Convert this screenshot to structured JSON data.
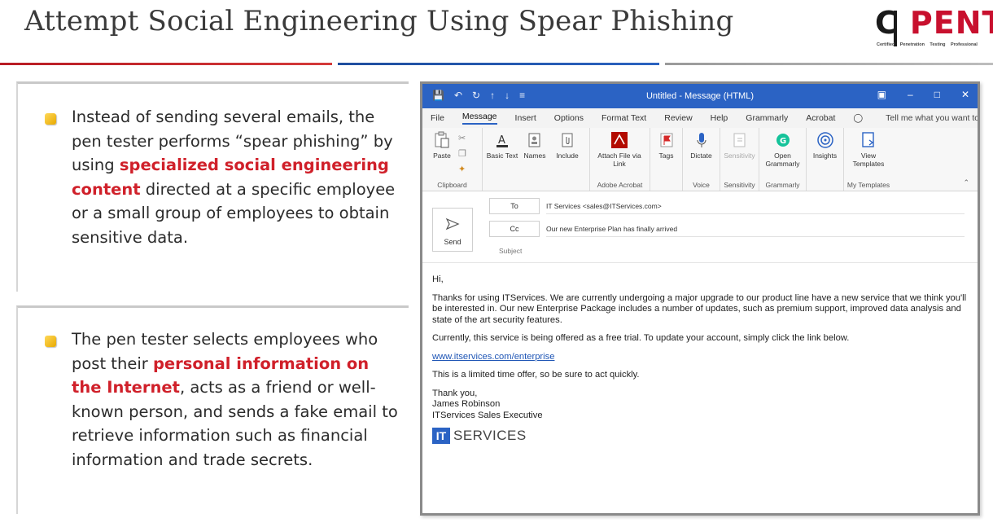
{
  "slide": {
    "title": "Attempt Social Engineering Using Spear Phishing",
    "logo": {
      "main_c": "C",
      "main_rest": "PENT",
      "sub_words": [
        "Certified",
        "Penetration",
        "Testing",
        "Professional"
      ]
    }
  },
  "bullets": [
    {
      "pre": "Instead of sending several emails, the pen tester performs “spear phishing” by using ",
      "highlight": "specialized social engineering content",
      "post": " directed at a specific employee or a small group of employees to obtain sensitive data."
    },
    {
      "pre": "The pen tester selects employees who post their ",
      "highlight": "personal information on the Internet",
      "post": ", acts as a friend or well-known person, and sends a fake email to retrieve information such as financial information and trade secrets."
    }
  ],
  "outlook": {
    "window_title": "Untitled  -  Message (HTML)",
    "menu": [
      "File",
      "Message",
      "Insert",
      "Options",
      "Format Text",
      "Review",
      "Help",
      "Grammarly",
      "Acrobat"
    ],
    "menu_active": "Message",
    "tell_me": "Tell me what you want to",
    "ribbon_groups": [
      {
        "label": "Clipboard",
        "buttons": [
          {
            "label": "Paste",
            "icon": "paste-icon"
          }
        ]
      },
      {
        "label": "",
        "buttons": [
          {
            "label": "Basic Text",
            "icon": "font-color-icon"
          },
          {
            "label": "Names",
            "icon": "address-book-icon"
          },
          {
            "label": "Include",
            "icon": "paperclip-icon"
          }
        ]
      },
      {
        "label": "Adobe Acrobat",
        "buttons": [
          {
            "label": "Attach File via Link",
            "icon": "acrobat-icon"
          }
        ]
      },
      {
        "label": "",
        "buttons": [
          {
            "label": "Tags",
            "icon": "flag-icon"
          }
        ]
      },
      {
        "label": "Voice",
        "buttons": [
          {
            "label": "Dictate",
            "icon": "microphone-icon"
          }
        ]
      },
      {
        "label": "Sensitivity",
        "buttons": [
          {
            "label": "Sensitivity",
            "icon": "sensitivity-icon"
          }
        ]
      },
      {
        "label": "Grammarly",
        "buttons": [
          {
            "label": "Open Grammarly",
            "icon": "grammarly-icon"
          }
        ]
      },
      {
        "label": "",
        "buttons": [
          {
            "label": "Insights",
            "icon": "insights-icon"
          }
        ]
      },
      {
        "label": "My Templates",
        "buttons": [
          {
            "label": "View Templates",
            "icon": "templates-icon"
          }
        ]
      }
    ],
    "compose": {
      "send_label": "Send",
      "to_label": "To",
      "to_value": "IT Services <sales@ITServices.com>",
      "cc_label": "Cc",
      "cc_value": "Our new Enterprise Plan has finally arrived",
      "subject_label": "Subject"
    },
    "email": {
      "greeting": "Hi,",
      "para1": "Thanks for using ITServices. We are currently undergoing a major upgrade to our product line have a new service that we think you'll be interested in. Our new Enterprise Package includes a number of updates, such as premium support, improved data analysis and state of the art security features.",
      "para2": "Currently, this service is being offered as a free trial. To update your account, simply click the link below.",
      "link": "www.itservices.com/enterprise",
      "para3": "This is a limited time offer, so be sure to act quickly.",
      "sign_thanks": "Thank you,",
      "sign_name": "James Robinson",
      "sign_role": "ITServices Sales Executive",
      "logo_it": "IT",
      "logo_services": "SERVICES"
    }
  },
  "colors": {
    "highlight_red": "#d0202a",
    "outlook_blue": "#2b63c4",
    "rule_red": "#b81c24",
    "rule_blue": "#1f4e9e",
    "rule_gray": "#9a9a9a"
  }
}
